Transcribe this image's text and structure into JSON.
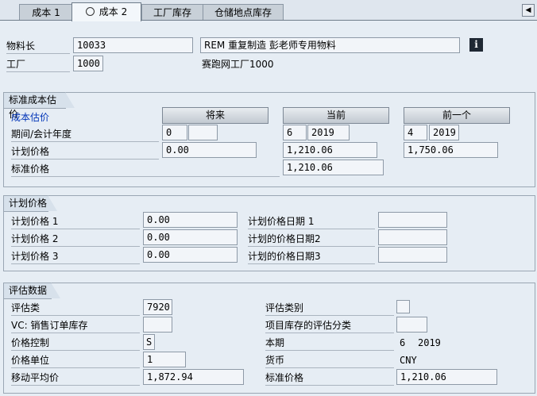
{
  "tabs": [
    {
      "label": "成本 1"
    },
    {
      "label": "成本 2"
    },
    {
      "label": "工厂库存"
    },
    {
      "label": "仓储地点库存"
    }
  ],
  "header": {
    "material_label": "物料长",
    "material_value": "10033",
    "material_desc": "REM 重复制造 彭老师专用物料",
    "plant_label": "工厂",
    "plant_value": "1000",
    "plant_desc": "赛跑网工厂1000"
  },
  "std_cost": {
    "title": "标准成本估价",
    "cost_estimate_label": "成本估价",
    "btn_future": "将来",
    "btn_current": "当前",
    "btn_previous": "前一个",
    "period_label": "期间/会计年度",
    "future_period": "0",
    "future_year": "",
    "current_period": "6",
    "current_year": "2019",
    "previous_period": "4",
    "previous_year": "2019",
    "plan_price_label": "计划价格",
    "future_price": "0.00",
    "current_price": "1,210.06",
    "previous_price": "1,750.06",
    "std_price_label": "标准价格",
    "std_price": "1,210.06"
  },
  "planned": {
    "title": "计划价格",
    "p1_label": "计划价格 1",
    "p1_value": "0.00",
    "p2_label": "计划价格 2",
    "p2_value": "0.00",
    "p3_label": "计划价格 3",
    "p3_value": "0.00",
    "d1_label": "计划价格日期 1",
    "d1_value": "",
    "d2_label": "计划的价格日期2",
    "d2_value": "",
    "d3_label": "计划的价格日期3",
    "d3_value": ""
  },
  "valuation": {
    "title": "评估数据",
    "class_label": "评估类",
    "class_value": "7920",
    "category_label": "评估类别",
    "category_value": "",
    "vc_label": "VC: 销售订单库存",
    "vc_value": "",
    "project_label": "项目库存的评估分类",
    "project_value": "",
    "price_control_label": "价格控制",
    "price_control_value": "S",
    "current_period_label": "本期",
    "current_period_value": "6",
    "current_year_value": "2019",
    "price_unit_label": "价格单位",
    "price_unit_value": "1",
    "currency_label": "货币",
    "currency_value": "CNY",
    "mavg_label": "移动平均价",
    "mavg_value": "1,872.94",
    "std_price_label": "标准价格",
    "std_price_value": "1,210.06"
  }
}
